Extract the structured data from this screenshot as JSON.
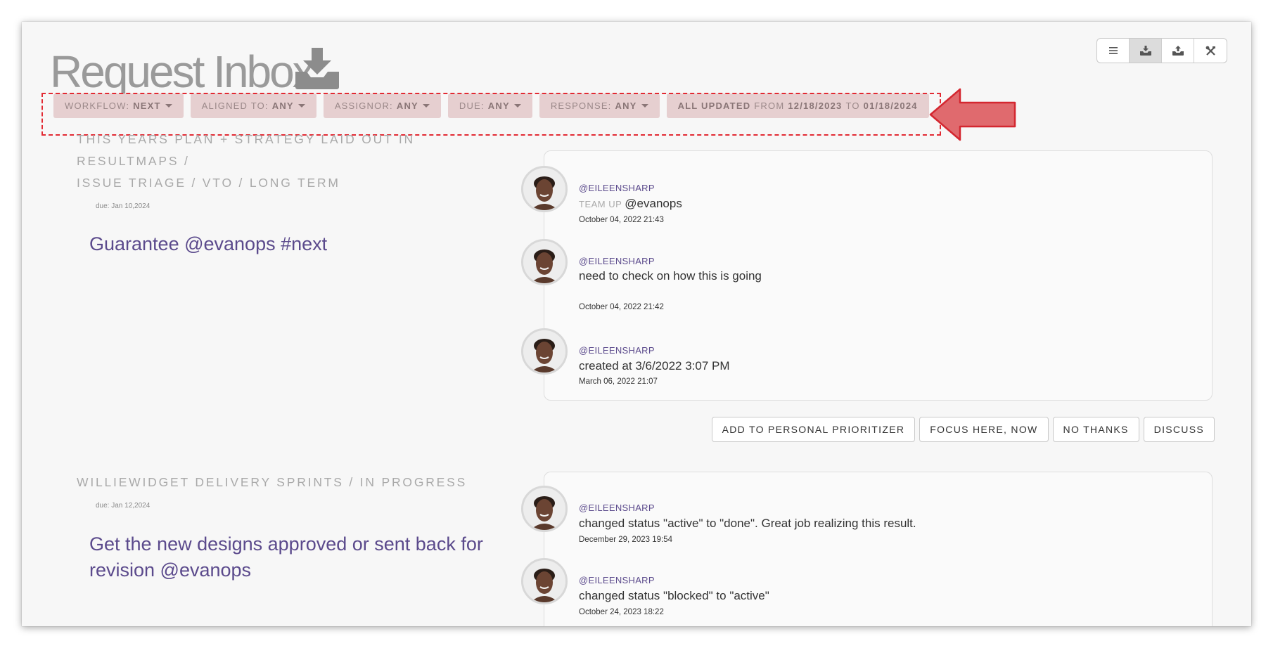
{
  "header": {
    "title": "Request Inbox",
    "title_icon": "inbox-download-icon"
  },
  "view_switch": [
    {
      "icon": "list-icon",
      "active": false
    },
    {
      "icon": "inbox-icon",
      "active": true
    },
    {
      "icon": "outbox-icon",
      "active": false
    },
    {
      "icon": "tools-icon",
      "active": false
    }
  ],
  "filters": {
    "workflow": {
      "label": "WORKFLOW:",
      "value": "NEXT"
    },
    "aligned": {
      "label": "ALIGNED TO:",
      "value": "ANY"
    },
    "assignor": {
      "label": "ASSIGNOR:",
      "value": "ANY"
    },
    "due": {
      "label": "DUE:",
      "value": "ANY"
    },
    "response": {
      "label": "RESPONSE:",
      "value": "ANY"
    },
    "updated": {
      "label": "ALL UPDATED",
      "from_word": "FROM",
      "from": "12/18/2023",
      "to_word": "TO",
      "to": "01/18/2024"
    }
  },
  "requests": [
    {
      "path_line1": "THIS YEARS PLAN + STRATEGY LAID OUT IN RESULTMAPS /",
      "path_line2": "ISSUE TRIAGE / VTO / LONG TERM",
      "due": "due: Jan 10,2024",
      "title": "Guarantee @evanops #next",
      "activities": [
        {
          "user": "@EILEENSHARP",
          "tag": "TEAM UP",
          "message": "@evanops",
          "timestamp": "October 04, 2022 21:43"
        },
        {
          "user": "@EILEENSHARP",
          "message": "need to check on how this is going",
          "timestamp": "October 04, 2022 21:42"
        },
        {
          "user": "@EILEENSHARP",
          "message": "created at 3/6/2022 3:07 PM",
          "timestamp": "March 06, 2022 21:07"
        }
      ],
      "actions": {
        "prioritizer": "ADD TO PERSONAL PRIORITIZER",
        "focus": "FOCUS HERE, NOW",
        "no_thanks": "NO THANKS",
        "discuss": "DISCUSS"
      }
    },
    {
      "path_line1": "WILLIEWIDGET DELIVERY SPRINTS / IN PROGRESS",
      "due": "due: Jan 12,2024",
      "title": "Get the new designs approved or sent back for revision @evanops",
      "activities": [
        {
          "user": "@EILEENSHARP",
          "message": "changed status \"active\" to \"done\". Great job realizing this result.",
          "timestamp": "December 29, 2023 19:54"
        },
        {
          "user": "@EILEENSHARP",
          "message": "changed status \"blocked\" to \"active\"",
          "timestamp": "October 24, 2023 18:22"
        }
      ]
    }
  ],
  "colors": {
    "accent": "#5b4a8c",
    "filter_bg": "#e6cfd0",
    "highlight": "#e22a33",
    "arrow": "#e06a6e"
  }
}
